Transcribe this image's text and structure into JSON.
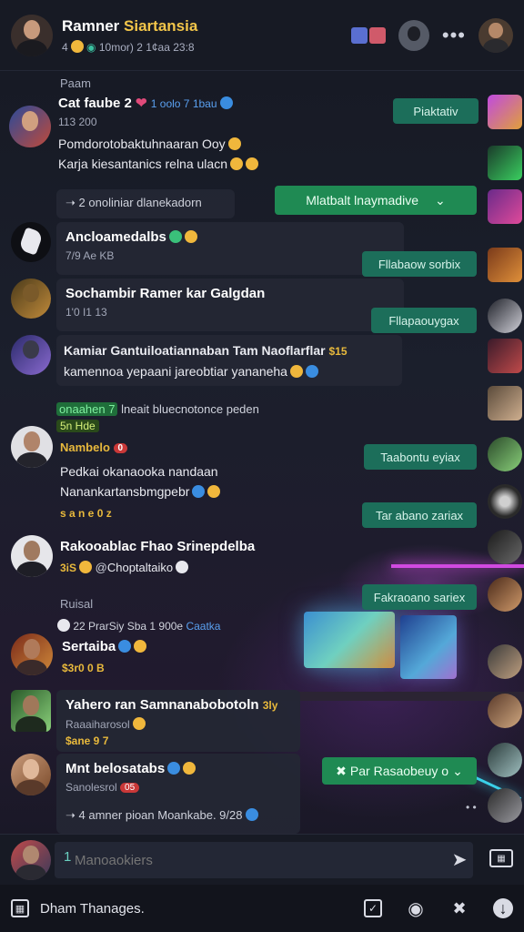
{
  "header": {
    "title_a": "Ramner ",
    "title_b": "Siartansia",
    "subtitle_a": "4",
    "subtitle_b": "10mor) 2 1¢aa 23:8"
  },
  "sections": {
    "s1": "Paam",
    "s2": "Ruisal"
  },
  "messages": [
    {
      "name": "Cat faube 2",
      "name_tail": "1 oolo 7 1bau",
      "meta": "113 200",
      "line1": "Pomdorotobaktuhnaaran Ooy",
      "line2": "Karja kiesantanics relna ulacn"
    },
    {
      "name": "Ancloamedalbs",
      "meta": "7/9 Ae KB"
    },
    {
      "name": "Sochambir Ramer kar Galgdan",
      "meta": "1'0 I1 13"
    },
    {
      "name": "Kamiar Gantuiloatiannaban Tam Naoflarflar",
      "name_tail": "$15",
      "line1": "kamennoa yepaani jareobtiar yananeha"
    },
    {
      "name": "Nambelo",
      "tag": "0",
      "line1": "Pedkai okanaooka nandaan",
      "line2": "Nanankartansbmgpebr",
      "meta": "s a n e 0 z"
    },
    {
      "name": "Rakooablac Fhao Srinepdelba",
      "meta": "3iS",
      "line1": "Choptaltaiko"
    },
    {
      "name": "Sertaiba",
      "meta": "$3r0 0 B"
    },
    {
      "name": "Yahero ran Samnanabobotoln",
      "name_tail": "3ly",
      "meta": "Raaaiharosol",
      "line1": "$ane 9 7"
    },
    {
      "name": "Mnt belosatabs",
      "meta": "Sanolesrol",
      "tag": "05"
    }
  ],
  "reply_lines": {
    "r1": "2 onoliniar dlanekadorn",
    "r2": "onaahen 7",
    "r2b": "lneait bluecnotonce peden",
    "r2c": "5n Hde",
    "r3": "22 PrarSiy Sba 1 900e",
    "r3b": "Caatka",
    "r4": "4 amner pioan Moankabe. 9/28"
  },
  "pills": {
    "p1": "Piaktativ",
    "p2": "Mlatbalt lnaymadive",
    "p3": "Fllabaow sorbix",
    "p4": "Fllapaouygax",
    "p5": "Taabontu eyiax",
    "p6": "Tar abano zariax",
    "p7": "Fakraoano sariex",
    "p8": "Par Rasaobeuy o"
  },
  "composer": {
    "prefix": "1",
    "placeholder": "Manoaokiers"
  },
  "bottom": {
    "label": "Dham Thanages."
  },
  "colors": {
    "accent_green": "#1f8a53",
    "pill_teal": "#1c6e5a",
    "gold": "#e8b93c",
    "bg": "#14161f"
  }
}
